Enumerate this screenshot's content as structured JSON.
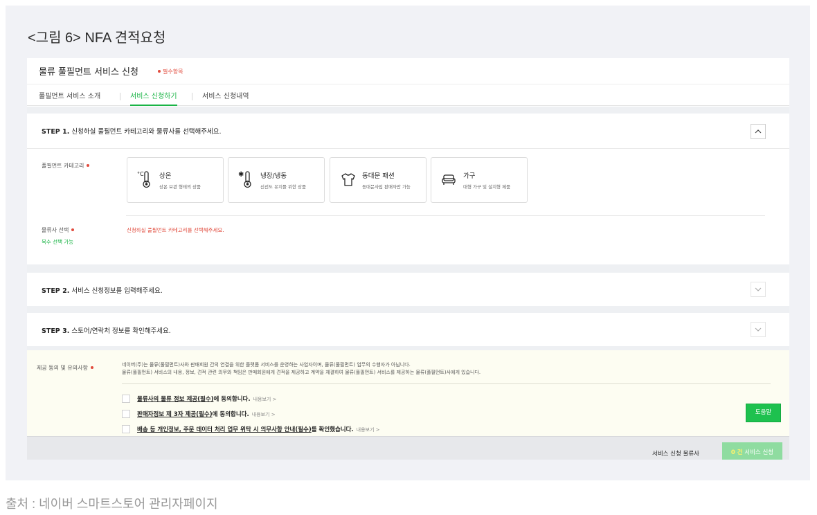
{
  "figure_title": "<그림 6> NFA 견적요청",
  "source_caption": "출처 : 네이버 스마트스토어 관리자페이지",
  "header": {
    "title": "물류 풀필먼트 서비스 신청",
    "required_note": "필수항목"
  },
  "tabs": [
    {
      "label": "풀필먼트 서비스 소개",
      "active": false
    },
    {
      "label": "서비스 신청하기",
      "active": true
    },
    {
      "label": "서비스 신청내역",
      "active": false
    }
  ],
  "step1": {
    "num": "STEP 1.",
    "title": "신청하실 풀필먼트 카테고리와 물류사를 선택해주세요.",
    "category_label": "풀필먼트 카테고리",
    "categories": [
      {
        "icon": "thermometer-room-temp-icon",
        "name": "상온",
        "desc": "상온 보관 형태의 상품"
      },
      {
        "icon": "thermometer-frozen-icon",
        "name": "냉장/냉동",
        "desc": "신선도 유지를 위한 상품"
      },
      {
        "icon": "tshirt-icon",
        "name": "동대문 패션",
        "desc": "동대문사입 판매자만 가능"
      },
      {
        "icon": "sofa-icon",
        "name": "가구",
        "desc": "대형 가구 및 설치형 제품"
      }
    ],
    "logistics_label": "물류사 선택",
    "logistics_sub": "복수 선택 가능",
    "logistics_warning": "신청하실 풀필먼트 카테고리를 선택해주세요."
  },
  "step2": {
    "num": "STEP 2.",
    "title": "서비스 신청정보를 입력해주세요."
  },
  "step3": {
    "num": "STEP 3.",
    "title": "스토어/연락처 정보를 확인해주세요."
  },
  "agreement": {
    "label": "제공 동의 및 유의사항",
    "para1": "네이버(주)는 물류(풀필먼트)사와 판매회원 간의 연결을 위한 플랫폼 서비스를 운영하는 사업자이며, 물류(풀필먼트) 업무의 수행자가 아닙니다.",
    "para2": "물류(풀필먼트) 서비스의 내용, 정보, 견적 관련 의무와 책임은 판매회원에게 견적을 제공하고 계약을 체결하여 물류(풀필먼트) 서비스를 제공하는 물류(풀필먼트)사에게 있습니다.",
    "items": [
      {
        "underlined": "물류사의 물류 정보 제공(필수)",
        "rest": "에 동의합니다.",
        "more": "내용보기 >"
      },
      {
        "underlined": "판매자정보 제 3자 제공(필수)",
        "rest": "에 동의합니다.",
        "more": "내용보기 >"
      },
      {
        "underlined": "배송 등 개인정보, 주문 데이터 처리 업무 위탁 시 의무사항 안내(필수)",
        "rest": "를 확인했습니다.",
        "more": "내용보기 >"
      }
    ]
  },
  "help_button": "도움말",
  "bottom": {
    "label": "서비스 신청 물류사",
    "count": "0 건",
    "submit": "서비스 신청"
  },
  "colors": {
    "accent_green": "#1ab446",
    "required_red": "#e14b3d"
  }
}
